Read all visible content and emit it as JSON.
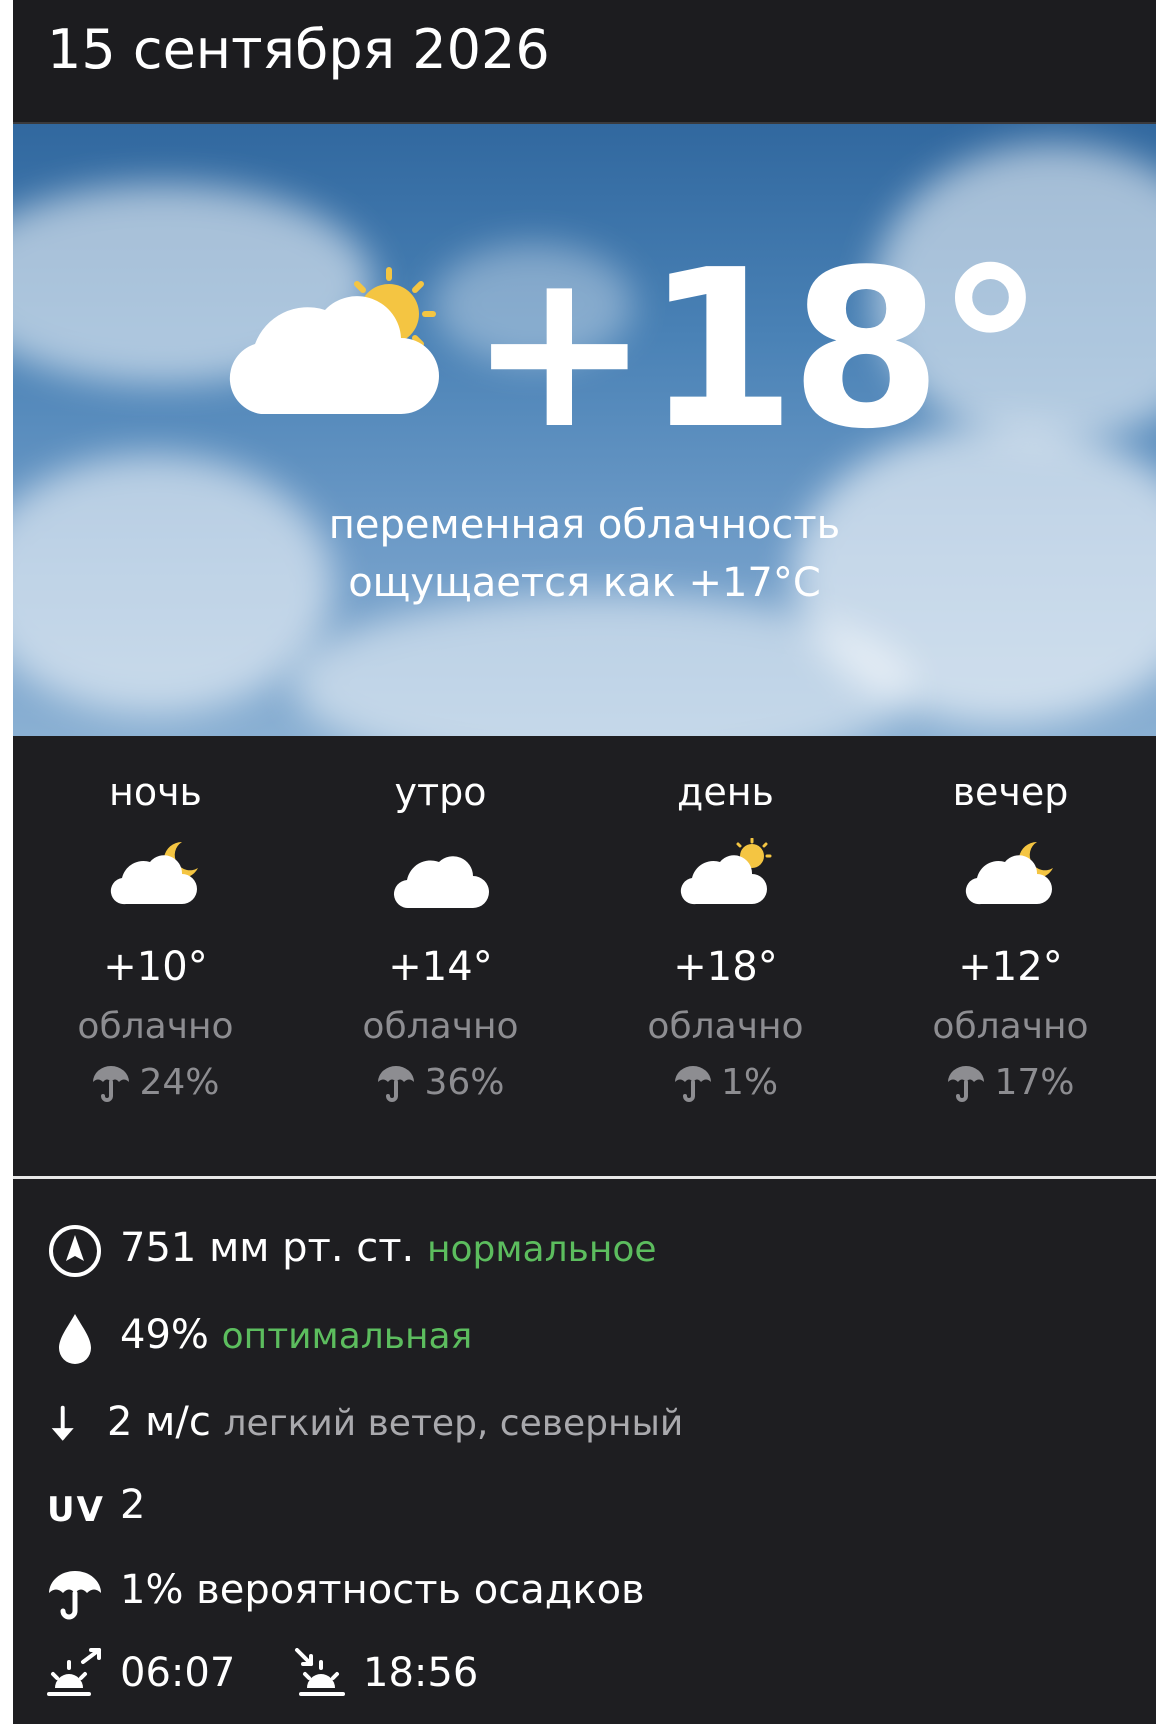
{
  "header": {
    "date": "15 сентября 2026"
  },
  "current": {
    "temperature": "+18°",
    "condition": "переменная облачность",
    "feels_like": "ощущается как +17°C",
    "icon": "cloud-sun-icon"
  },
  "periods": [
    {
      "name": "ночь",
      "icon": "cloud-moon-icon",
      "temperature": "+10°",
      "condition": "облачно",
      "precip": "24%"
    },
    {
      "name": "утро",
      "icon": "cloud-icon",
      "temperature": "+14°",
      "condition": "облачно",
      "precip": "36%"
    },
    {
      "name": "день",
      "icon": "cloud-sun-icon",
      "temperature": "+18°",
      "condition": "облачно",
      "precip": "1%"
    },
    {
      "name": "вечер",
      "icon": "cloud-moon-icon",
      "temperature": "+12°",
      "condition": "облачно",
      "precip": "17%"
    }
  ],
  "details": {
    "pressure": {
      "icon": "compass-icon",
      "value": "751 мм рт. ст.",
      "status": "нормальное"
    },
    "humidity": {
      "icon": "droplet-icon",
      "value": "49%",
      "status": "оптимальная"
    },
    "wind": {
      "icon": "arrow-down-icon",
      "value": "2 м/с",
      "description": "легкий ветер, северный"
    },
    "uv": {
      "label": "UV",
      "value": "2"
    },
    "precipitation": {
      "icon": "umbrella-icon",
      "value": "1% вероятность осадков"
    },
    "sunrise": {
      "icon": "sunrise-icon",
      "value": "06:07"
    },
    "sunset": {
      "icon": "sunset-icon",
      "value": "18:56"
    }
  },
  "colors": {
    "background": "#1e1e21",
    "accent_green": "#5cbd5e",
    "muted_text": "#8d8d91"
  }
}
